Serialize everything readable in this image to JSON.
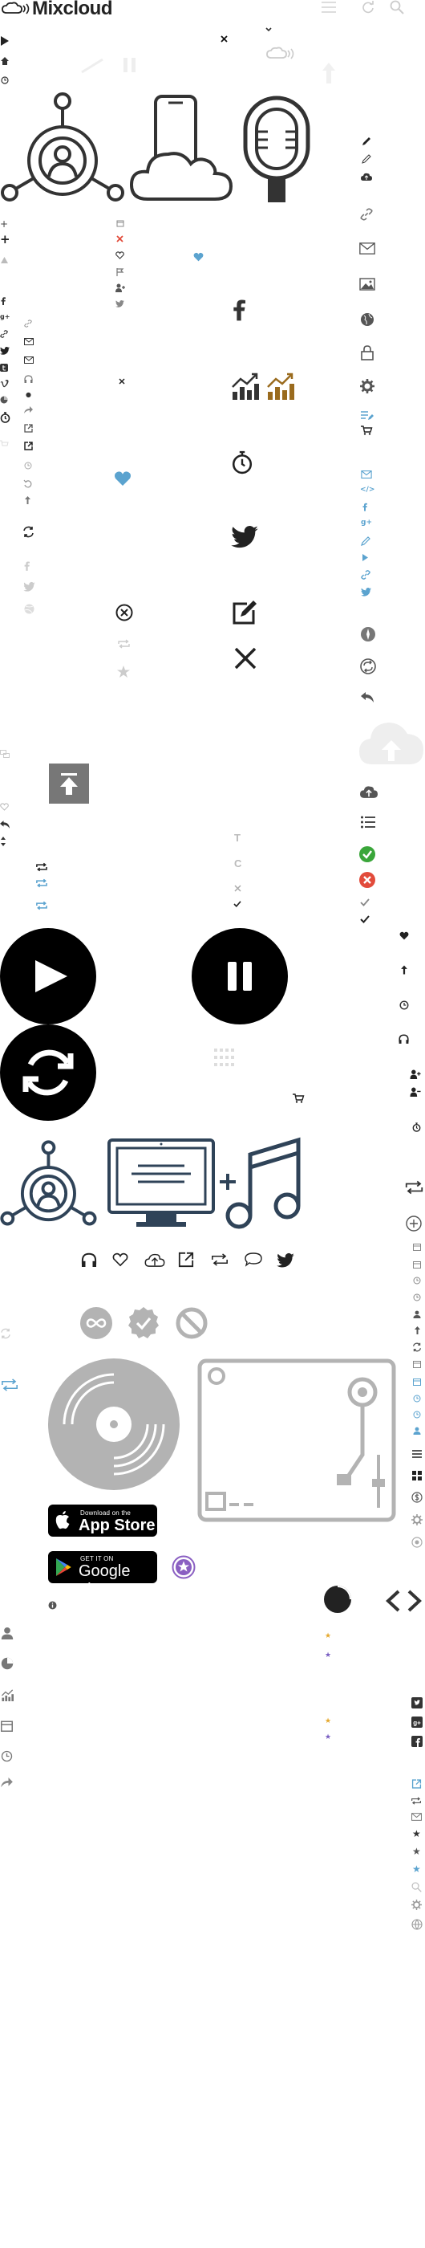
{
  "brand": {
    "name": "Mixcloud"
  },
  "badges": {
    "appstore": {
      "line1": "Download on the",
      "line2": "App Store"
    },
    "googleplay": {
      "line1": "GET IT ON",
      "line2": "Google play"
    }
  },
  "letters": {
    "t": "T",
    "c": "C"
  },
  "colors": {
    "blue": "#5ba3cf",
    "green": "#3aa63a",
    "red": "#e24b3b",
    "gold": "#9a6b1e",
    "purple": "#8a5fc2",
    "grey": "#b3b3b3",
    "dark": "#333333"
  }
}
